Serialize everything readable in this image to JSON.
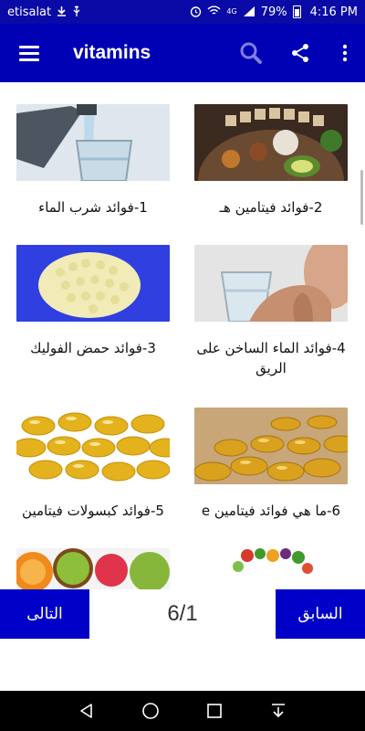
{
  "status_bar": {
    "carrier": "etisalat",
    "battery": "79%",
    "time": "4:16 PM",
    "signal_label": "4G"
  },
  "app_bar": {
    "title": "vitamins",
    "icons": [
      "menu-icon",
      "search-icon",
      "share-icon",
      "more-vert-icon"
    ]
  },
  "items": [
    {
      "label": "1-فوائد شرب الماء",
      "image": "water-pour-image"
    },
    {
      "label": "2-فوائد فيتامين هـ",
      "image": "vitamin-e-foods-image"
    },
    {
      "label": "3-فوائد حمض الفوليك",
      "image": "folic-acid-pills-image"
    },
    {
      "label": "4-فوائد الماء الساخن على الريق",
      "image": "man-drinking-water-image"
    },
    {
      "label": "5-فوائد كبسولات فيتامين",
      "image": "vitamin-capsules-image"
    },
    {
      "label": "6-ما هي فوائد فيتامين e",
      "image": "vitamin-e-capsules-image"
    },
    {
      "label": "",
      "image": "fruits-image"
    },
    {
      "label": "",
      "image": "vegetables-image"
    }
  ],
  "pager": {
    "next_label": "التالى",
    "prev_label": "السابق",
    "page_indicator": "6/1"
  },
  "colors": {
    "status_bar": "#0a0aa6",
    "app_bar": "#0000b4",
    "pager_button": "#0000c8"
  }
}
